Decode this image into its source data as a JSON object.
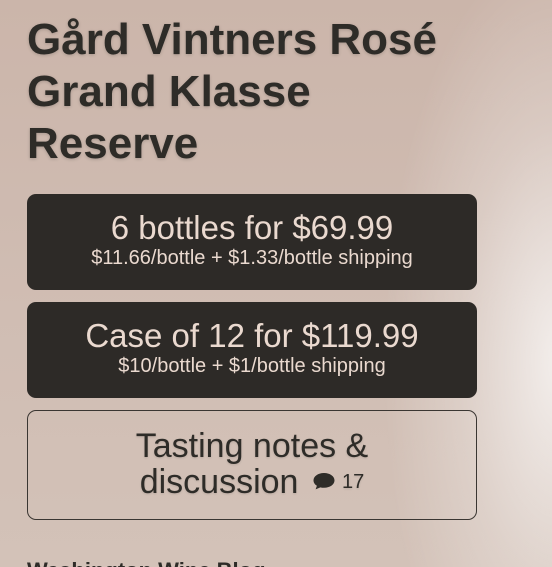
{
  "product": {
    "title_lines": [
      "Gård Vintners Rosé",
      "Grand Klasse",
      "Reserve"
    ]
  },
  "offers": [
    {
      "main": "6 bottles for $69.99",
      "sub": "$11.66/bottle + $1.33/bottle shipping"
    },
    {
      "main": "Case of 12 for $119.99",
      "sub": "$10/bottle + $1/bottle shipping"
    }
  ],
  "discussion": {
    "line1": "Tasting notes &",
    "line2": "discussion",
    "comment_count": "17",
    "comment_icon": "speech-bubble-icon"
  },
  "footer": {
    "text": "Washington Wine Blog"
  },
  "colors": {
    "background": "#cdb8ad",
    "button_dark": "#2d2a27",
    "button_text": "#ead9cf",
    "text_dark": "#2e2c28"
  }
}
